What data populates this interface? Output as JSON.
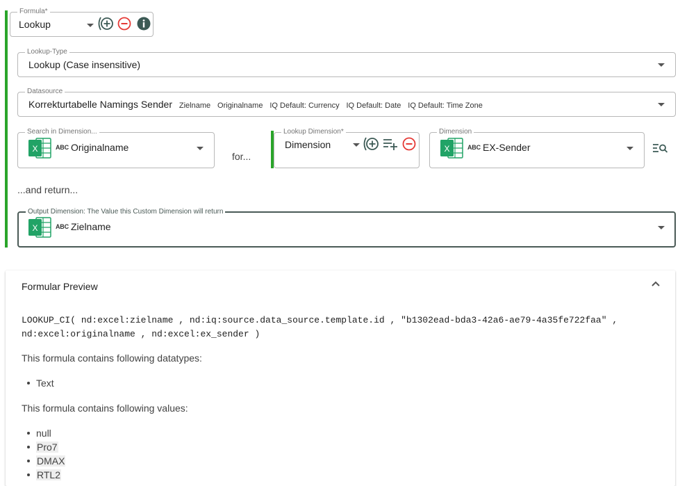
{
  "formula": {
    "legend": "Formula*",
    "value": "Lookup"
  },
  "lookup_type": {
    "legend": "Lookup-Type",
    "value": "Lookup (Case insensitive)"
  },
  "datasource": {
    "legend": "Datasource",
    "value": "Korrekturtabelle Namings Sender",
    "tags": [
      "Zielname",
      "Originalname",
      "IQ Default: Currency",
      "IQ Default: Date",
      "IQ Default: Time Zone"
    ]
  },
  "search_dim": {
    "legend": "Search in Dimension...",
    "type_badge": "ABC",
    "value": "Originalname"
  },
  "for_label": "for...",
  "lookup_dim": {
    "legend": "Lookup Dimension*",
    "value": "Dimension"
  },
  "dimension": {
    "legend": "Dimension",
    "type_badge": "ABC",
    "value": "EX-Sender"
  },
  "and_return_label": "...and return...",
  "output_dim": {
    "legend": "Output Dimension: The Value this Custom Dimension will return",
    "type_badge": "ABC",
    "value": "Zielname"
  },
  "preview": {
    "title": "Formular Preview",
    "code_line1": "LOOKUP_CI( nd:excel:zielname , nd:iq:source.data_source.template.id , \"b1302ead-bda3-42a6-ae79-4a35fe722faa\" ,",
    "code_line2": "nd:excel:originalname , nd:excel:ex_sender )",
    "datatypes_label": "This formula contains following datatypes:",
    "datatypes": [
      "Text"
    ],
    "values_label": "This formula contains following values:",
    "values": [
      "null",
      "Pro7",
      "DMAX",
      "RTL2"
    ]
  },
  "colors": {
    "green": "#2aa52a",
    "red": "#e53935",
    "teal_dark": "#3c5a55",
    "excel_green": "#21a366"
  }
}
